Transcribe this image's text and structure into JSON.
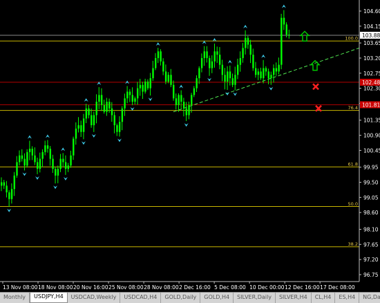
{
  "chart_data": {
    "type": "candlestick",
    "symbol": "USDJPY",
    "timeframe": "H4",
    "y_ticks": [
      "104.60",
      "104.15",
      "103.65",
      "103.20",
      "102.75",
      "102.30",
      "101.85",
      "101.35",
      "100.90",
      "100.45",
      "99.95",
      "99.50",
      "99.05",
      "98.60",
      "98.10",
      "97.65",
      "97.20",
      "96.75"
    ],
    "ylim": [
      96.75,
      104.6
    ],
    "x_ticks": [
      "13 Nov 08:00",
      "18 Nov 08:00",
      "20 Nov 16:00",
      "25 Nov 08:00",
      "28 Nov 08:00",
      "2 Dec 16:00",
      "5 Dec 08:00",
      "10 Dec 00:00",
      "12 Dec 16:00",
      "17 Dec 08:00"
    ],
    "price_boxes": [
      {
        "label": "103.88",
        "value": 103.88,
        "bg": "#ffffff",
        "fg": "#000000"
      },
      {
        "label": "102.48",
        "value": 102.48,
        "bg": "#cc0000",
        "fg": "#ffffff"
      },
      {
        "label": "101.81",
        "value": 101.81,
        "bg": "#cc0000",
        "fg": "#ffffff"
      }
    ],
    "fib_levels": [
      {
        "label": "100.0",
        "value": 103.71
      },
      {
        "label": "76.4",
        "value": 101.64
      },
      {
        "label": "61.8",
        "value": 99.96
      },
      {
        "label": "50.0",
        "value": 98.78
      },
      {
        "label": "38.2",
        "value": 97.58
      }
    ],
    "red_lines": [
      102.48,
      101.81
    ],
    "gray_line": 103.88,
    "trendline": {
      "from": {
        "x": "5 Dec 08:00",
        "y": 101.6
      },
      "to": {
        "x": "19 Dec",
        "y": 103.5
      }
    },
    "close_series": [
      99.5,
      99.4,
      99.2,
      99.0,
      99.3,
      99.7,
      100.1,
      100.3,
      100.2,
      100.0,
      100.4,
      100.5,
      100.3,
      100.1,
      99.9,
      100.2,
      100.4,
      100.6,
      100.5,
      100.2,
      99.9,
      99.7,
      99.9,
      100.2,
      100.1,
      99.9,
      100.0,
      100.3,
      100.8,
      101.1,
      101.2,
      101.0,
      101.4,
      101.7,
      101.5,
      101.2,
      101.5,
      101.9,
      102.1,
      101.8,
      101.6,
      101.9,
      101.7,
      101.5,
      101.2,
      101.0,
      101.3,
      101.7,
      102.0,
      102.2,
      102.1,
      101.9,
      102.0,
      102.3,
      102.4,
      102.2,
      102.5,
      102.3,
      102.6,
      102.9,
      103.2,
      103.4,
      103.1,
      102.8,
      102.5,
      102.7,
      102.4,
      102.0,
      101.8,
      102.1,
      101.9,
      101.7,
      101.5,
      101.8,
      102.1,
      102.3,
      102.6,
      102.9,
      103.2,
      103.4,
      103.2,
      102.9,
      103.1,
      103.4,
      103.3,
      103.0,
      102.7,
      102.5,
      102.8,
      102.6,
      102.4,
      102.7,
      103.0,
      103.2,
      103.5,
      103.8,
      103.6,
      103.3,
      102.9,
      102.7,
      102.8,
      102.6,
      102.9,
      102.8,
      102.6,
      102.7,
      102.9,
      102.8,
      103.0,
      104.4,
      104.2,
      103.9,
      103.88
    ],
    "fractal_up_marks": 30,
    "fractal_down_marks": 28,
    "arrows": [
      {
        "kind": "buy",
        "color": "#00c800",
        "at": "17 Dec 08:00",
        "value": 103.85
      },
      {
        "kind": "buy",
        "color": "#00c800",
        "at": "18 Dec",
        "value": 102.98
      },
      {
        "kind": "sell",
        "color": "#ff2020",
        "at": "18 Dec",
        "value": 102.35
      },
      {
        "kind": "sell",
        "color": "#ff2020",
        "at": "18 Dec",
        "value": 101.7
      }
    ],
    "colors": {
      "background": "#000000",
      "candle": "#00ff00",
      "fractal": "#3cc8e6",
      "fib": "#c8b400",
      "red_level": "#b40000",
      "trendline": "#50e650",
      "axis": "#c0c0c0"
    }
  },
  "tabs": [
    {
      "label": "Monthly",
      "active": false
    },
    {
      "label": "USDJPY,H4",
      "active": true
    },
    {
      "label": "USDCAD,Weekly",
      "active": false
    },
    {
      "label": "USDCAD,H4",
      "active": false
    },
    {
      "label": "GOLD,Daily",
      "active": false
    },
    {
      "label": "GOLD,H4",
      "active": false
    },
    {
      "label": "SILVER,Daily",
      "active": false
    },
    {
      "label": "SILVER,H4",
      "active": false
    },
    {
      "label": "CL,H4",
      "active": false
    },
    {
      "label": "ES,H4",
      "active": false
    },
    {
      "label": "NG,Daily",
      "active": false
    }
  ]
}
